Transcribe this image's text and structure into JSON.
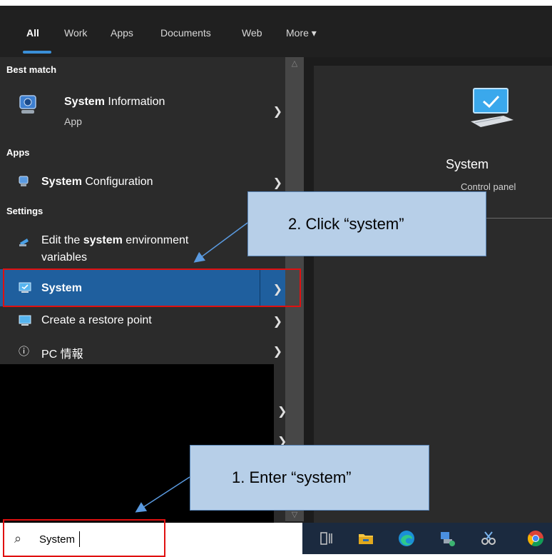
{
  "tabs": {
    "items": [
      "All",
      "Work",
      "Apps",
      "Documents",
      "Web",
      "More ▾"
    ],
    "active": "All"
  },
  "sections": {
    "best_match": "Best match",
    "apps": "Apps",
    "settings": "Settings"
  },
  "results": {
    "system_information": {
      "bold": "System",
      "rest": " Information",
      "sub": "App"
    },
    "system_configuration": {
      "bold": "System",
      "rest": " Configuration"
    },
    "edit_env_1_pre": "Edit the ",
    "edit_env_1_bold": "system",
    "edit_env_1_post": " environment",
    "edit_env_2": "variables",
    "system": "System",
    "restore_point": "Create a restore point",
    "pc_info": "PC 情報"
  },
  "preview": {
    "title": "System",
    "subtitle": "Control panel"
  },
  "callouts": {
    "step2": "2.  Click “system”",
    "step1": "1.  Enter “system”"
  },
  "search": {
    "value": "System"
  },
  "colors": {
    "accent": "#1f5f9e",
    "highlight_box": "#e01010",
    "callout_fill": "#b7cfe8"
  }
}
